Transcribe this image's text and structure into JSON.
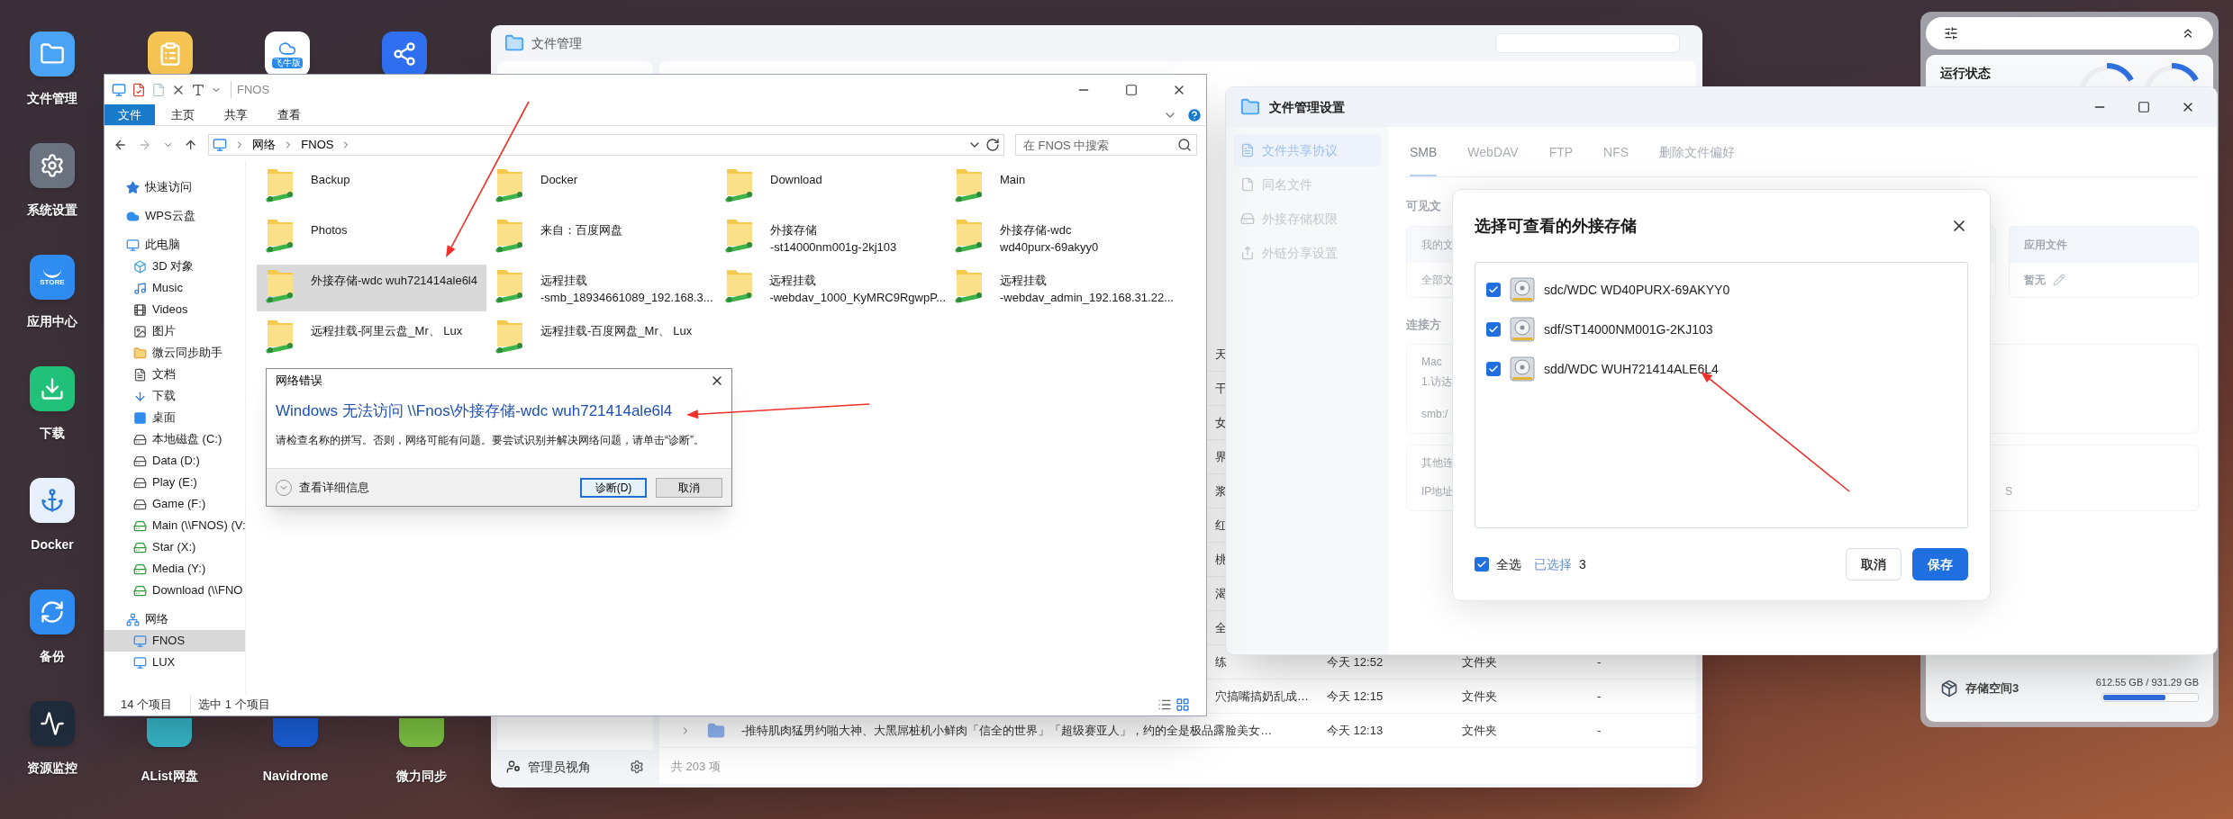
{
  "desktop": {
    "column_apps": [
      {
        "kind": "files",
        "label": "文件管理"
      },
      {
        "kind": "settings",
        "label": "系统设置"
      },
      {
        "kind": "store",
        "label": "应用中心",
        "icon_text": "STORE"
      },
      {
        "kind": "download",
        "label": "下载"
      },
      {
        "kind": "docker",
        "label": "Docker"
      },
      {
        "kind": "backup",
        "label": "备份"
      },
      {
        "kind": "monitor",
        "label": "资源监控"
      }
    ],
    "top_apps": [
      {
        "kind": "notes"
      },
      {
        "kind": "feiniu",
        "icon_text": "飞牛版"
      },
      {
        "kind": "share"
      }
    ],
    "bottom_apps": [
      {
        "kind": "alist",
        "label": "AList网盘"
      },
      {
        "kind": "navidrome",
        "label": "Navidrome"
      },
      {
        "kind": "weili",
        "label": "微力同步"
      }
    ]
  },
  "file_manager": {
    "title": "文件管理",
    "rows": [
      {
        "kind": "partial",
        "name": "天"
      },
      {
        "kind": "partial",
        "name": "干"
      },
      {
        "kind": "partial",
        "name": "女"
      },
      {
        "kind": "partial",
        "name": "界"
      },
      {
        "kind": "partial",
        "name": "浆"
      },
      {
        "kind": "partial",
        "name": "红"
      },
      {
        "kind": "partial",
        "name": "桃"
      },
      {
        "kind": "partial",
        "name": "渴"
      },
      {
        "kind": "partial",
        "name": "全"
      },
      {
        "kind": "partial",
        "name": "练",
        "time": "今天 12:52",
        "type": "文件夹",
        "size": "-"
      },
      {
        "kind": "partial",
        "name": "穴搞嘴搞奶乱成…",
        "time": "今天 12:15",
        "type": "文件夹",
        "size": "-"
      },
      {
        "kind": "expandable",
        "name": "-推特肌肉猛男约啪大神、大黑屌桩机小鲜肉「信全的世界」「超级赛亚人」，约的全是极品露脸美女…",
        "time": "今天 12:13",
        "type": "文件夹",
        "size": "-"
      }
    ],
    "footer": {
      "user_view": "管理员视角",
      "count": "共 203 项"
    }
  },
  "explorer": {
    "title": "FNOS",
    "ribbon_tabs": [
      {
        "label": "文件",
        "selected": true
      },
      {
        "label": "主页",
        "selected": false
      },
      {
        "label": "共享",
        "selected": false
      },
      {
        "label": "查看",
        "selected": false
      }
    ],
    "breadcrumb": [
      "网络",
      "FNOS"
    ],
    "search": {
      "placeholder": "在 FNOS 中搜索"
    },
    "nav": [
      {
        "kind": "quick",
        "label": "快速访问",
        "selected": false
      },
      {
        "kind": "cloud",
        "label": "WPS云盘",
        "selected": false
      },
      {
        "kind": "pc",
        "label": "此电脑",
        "selected": false,
        "children": [
          {
            "kind": "cube",
            "label": "3D 对象",
            "selected": false
          },
          {
            "kind": "music",
            "label": "Music",
            "selected": false
          },
          {
            "kind": "video",
            "label": "Videos",
            "selected": false
          },
          {
            "kind": "image",
            "label": "图片",
            "selected": false
          },
          {
            "kind": "weiyun",
            "label": "微云同步助手",
            "selected": false
          },
          {
            "kind": "doc",
            "label": "文档",
            "selected": false
          },
          {
            "kind": "download",
            "label": "下载",
            "selected": false
          },
          {
            "kind": "desktop",
            "label": "桌面",
            "selected": false
          },
          {
            "kind": "drive",
            "label": "本地磁盘 (C:)",
            "selected": false
          },
          {
            "kind": "drive",
            "label": "Data (D:)",
            "selected": false
          },
          {
            "kind": "drive",
            "label": "Play (E:)",
            "selected": false
          },
          {
            "kind": "drive",
            "label": "Game (F:)",
            "selected": false
          },
          {
            "kind": "netdrive",
            "label": "Main (\\\\FNOS) (V:",
            "selected": false
          },
          {
            "kind": "netdrive",
            "label": "Star (X:)",
            "selected": false
          },
          {
            "kind": "netdrive",
            "label": "Media (Y:)",
            "selected": false
          },
          {
            "kind": "netdrive",
            "label": "Download (\\\\FNO",
            "selected": false
          }
        ]
      },
      {
        "kind": "network",
        "label": "网络",
        "selected": false,
        "children": [
          {
            "kind": "computer",
            "label": "FNOS",
            "selected": true
          },
          {
            "kind": "computer",
            "label": "LUX",
            "selected": false
          }
        ]
      }
    ],
    "items": [
      {
        "lines": [
          "Backup"
        ],
        "selected": false
      },
      {
        "lines": [
          "Docker"
        ],
        "selected": false
      },
      {
        "lines": [
          "Download"
        ],
        "selected": false
      },
      {
        "lines": [
          "Main"
        ],
        "selected": false
      },
      {
        "lines": [
          "Photos"
        ],
        "selected": false
      },
      {
        "lines": [
          "来自：百度网盘"
        ],
        "selected": false
      },
      {
        "lines": [
          "外接存储",
          "-st14000nm001g-2kj103"
        ],
        "selected": false
      },
      {
        "lines": [
          "外接存储-wdc",
          "wd40purx-69akyy0"
        ],
        "selected": false
      },
      {
        "lines": [
          "外接存储-wdc wuh721414ale6l4"
        ],
        "selected": true
      },
      {
        "lines": [
          "远程挂载",
          "-smb_18934661089_192.168.3..."
        ],
        "selected": false
      },
      {
        "lines": [
          "远程挂载",
          "-webdav_1000_KyMRC9RgwpP..."
        ],
        "selected": false
      },
      {
        "lines": [
          "远程挂载",
          "-webdav_admin_192.168.31.22..."
        ],
        "selected": false
      },
      {
        "lines": [
          "远程挂载-阿里云盘_Mr、 Lux"
        ],
        "selected": false
      },
      {
        "lines": [
          "远程挂载-百度网盘_Mr、 Lux"
        ],
        "selected": false
      }
    ],
    "status": [
      "14 个项目",
      "选中 1 个项目"
    ]
  },
  "error_dialog": {
    "title": "网络错误",
    "heading": "Windows 无法访问 \\\\Fnos\\外接存储-wdc wuh721414ale6l4",
    "message": "请检查名称的拼写。否则，网络可能有问题。要尝试识别并解决网络问题，请单击“诊断”。",
    "details": "查看详细信息",
    "buttons": [
      {
        "label": "诊断(D)",
        "default": true
      },
      {
        "label": "取消",
        "default": false
      }
    ]
  },
  "settings": {
    "title": "文件管理设置",
    "nav": [
      {
        "kind": "doc",
        "label": "文件共享协议",
        "selected": true
      },
      {
        "kind": "file",
        "label": "同名文件",
        "selected": false
      },
      {
        "kind": "drive",
        "label": "外接存储权限",
        "selected": false
      },
      {
        "kind": "share",
        "label": "外链分享设置",
        "selected": false
      }
    ],
    "tabs": [
      {
        "label": "SMB",
        "selected": true
      },
      {
        "label": "WebDAV",
        "selected": false
      },
      {
        "label": "FTP",
        "selected": false
      },
      {
        "label": "NFS",
        "selected": false
      },
      {
        "label": "删除文件偏好",
        "selected": false
      }
    ],
    "background": {
      "visible_heading": "可见文",
      "card_header": "我的文",
      "card_value": "全部文",
      "connect_heading": "连接方",
      "mac_title": "Mac",
      "mac_step": "1.访达",
      "mac_url": "smb:/",
      "other_title": "其他连",
      "ip_label": "IP地址",
      "ip_tail": "S",
      "app_files": {
        "header": "应用文件",
        "value": "暂无"
      }
    },
    "modal": {
      "title": "选择可查看的外接存储",
      "drives": [
        {
          "label": "sdc/WDC WD40PURX-69AKYY0",
          "checked": true
        },
        {
          "label": "sdf/ST14000NM001G-2KJ103",
          "checked": true
        },
        {
          "label": "sdd/WDC WUH721414ALE6L4",
          "checked": true
        }
      ],
      "select_all": {
        "label": "全选",
        "checked": true
      },
      "selected_label": "已选择",
      "selected_count": "3",
      "buttons": [
        {
          "kind": "secondary",
          "label": "取消"
        },
        {
          "kind": "primary",
          "label": "保存"
        }
      ]
    }
  },
  "widget": {
    "status_title": "运行状态",
    "storage": {
      "name": "存储空间3",
      "usage": "612.55 GB / 931.29 GB",
      "level": 0.66
    }
  }
}
